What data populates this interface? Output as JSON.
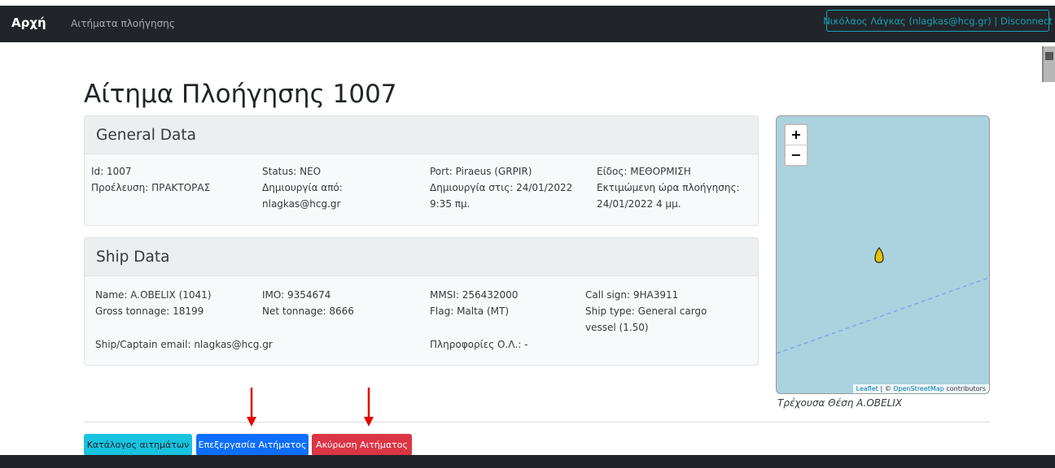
{
  "nav": {
    "brand": "Αρχή",
    "link": "Αιτήματα πλοήγησης",
    "user_button": "Νικόλαος Λάγκας (nlagkas@hcg.gr) | Disconnect"
  },
  "page_title": "Αίτημα Πλοήγησης 1007",
  "general": {
    "header": "General Data",
    "id": "Id: 1007",
    "origin": "Προέλευση: ΠΡΑΚΤΟΡΑΣ",
    "status": "Status: ΝΕΟ",
    "created_by_label": "Δημιουργία από:",
    "created_by": "nlagkas@hcg.gr",
    "port": "Port: Piraeus (GRPIR)",
    "created_at_label": "Δημιουργία στις: 24/01/2022",
    "created_at_time": "9:35 πμ.",
    "kind": "Είδος: ΜΕΘΟΡΜΙΣΗ",
    "eta_label": "Εκτιμώμενη ώρα πλοήγησης:",
    "eta_value": "24/01/2022 4 μμ."
  },
  "ship": {
    "header": "Ship Data",
    "name": "Name: A.OBELIX (1041)",
    "gross": "Gross tonnage: 18199",
    "imo": "IMO: 9354674",
    "net": "Net tonnage: 8666",
    "mmsi": "MMSI: 256432000",
    "flag": "Flag: Malta (MT)",
    "callsign": "Call sign: 9HA3911",
    "type_line1": "Ship type: General cargo",
    "type_line2": "vessel (1.50)",
    "email": "Ship/Captain email: nlagkas@hcg.gr",
    "info": "Πληροφορίες Ο.Λ.: -"
  },
  "map": {
    "zoom_in": "+",
    "zoom_out": "−",
    "attrib_leaflet": "Leaflet",
    "attrib_sep": " | © ",
    "attrib_osm": "OpenStreetMap",
    "attrib_tail": " contributors",
    "label": "Τρέχουσα Θέση A.OBELIX",
    "marker_color": "#e6c300"
  },
  "buttons": {
    "list": "Κατάλογος αιτημάτων",
    "edit": "Επεξεργασία Αιτήματος",
    "cancel": "Ακύρωση Αιτήματος"
  },
  "colors": {
    "annotation_arrow": "#e60000"
  }
}
